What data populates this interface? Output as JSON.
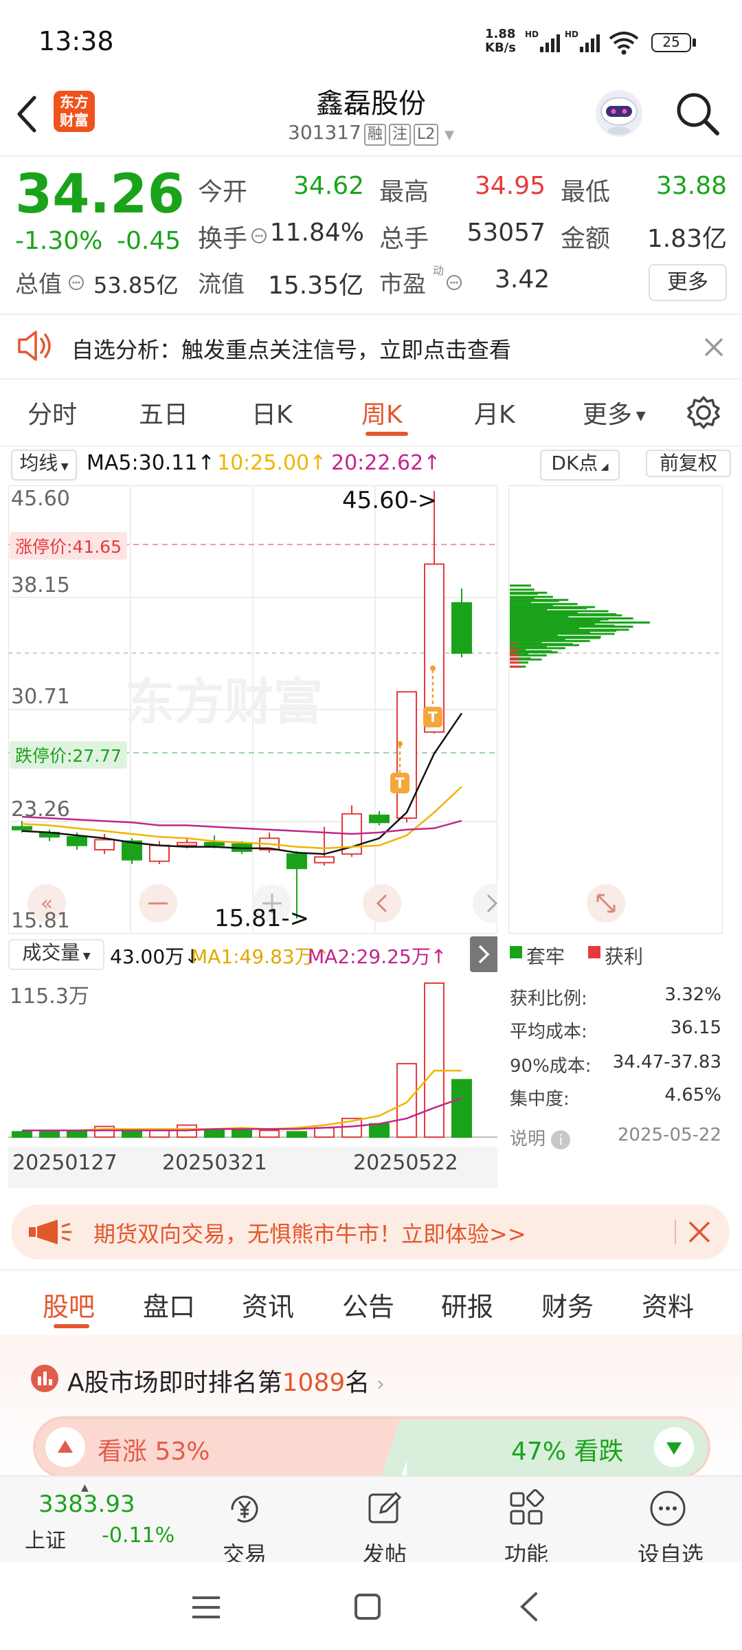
{
  "status": {
    "time": "13:38",
    "net_speed": "1.88",
    "net_unit": "KB/s",
    "battery": "25"
  },
  "header": {
    "app_logo": "东方财富",
    "title": "鑫磊股份",
    "code": "301317",
    "tags": [
      "融",
      "注",
      "L2"
    ]
  },
  "quote": {
    "price": "34.26",
    "change_pct": "-1.30%",
    "change": "-0.45",
    "rows": [
      [
        {
          "label": "今开",
          "value": "34.62",
          "color": "green"
        },
        {
          "label": "最高",
          "value": "34.95",
          "color": "red"
        },
        {
          "label": "最低",
          "value": "33.88",
          "color": "green"
        }
      ],
      [
        {
          "label": "换手",
          "value": "11.84%",
          "color": "plain"
        },
        {
          "label": "总手",
          "value": "53057",
          "color": "plain"
        },
        {
          "label": "金额",
          "value": "1.83亿",
          "color": "plain"
        }
      ]
    ],
    "row3": {
      "total_value_label": "总值",
      "total_value": "53.85亿",
      "float_label": "流值",
      "float_value": "15.35亿",
      "pe_label": "市盈",
      "pe_sup": "动",
      "pe_value": "3.42"
    },
    "more": "更多"
  },
  "notice": {
    "text": "自选分析：触发重点关注信号，立即点击查看"
  },
  "chart_tabs": [
    "分时",
    "五日",
    "日K",
    "周K",
    "月K",
    "更多"
  ],
  "active_tab": "周K",
  "indicators": {
    "selector": "均线",
    "ma5": "MA5:30.11↑",
    "ma10": "10:25.00↑",
    "ma20": "20:22.62↑",
    "dk": "DK点",
    "adjust": "前复权"
  },
  "price_axis": {
    "top": "45.60",
    "l2": "38.15",
    "l3": "30.71",
    "l4": "23.26",
    "bottom": "15.81"
  },
  "limits": {
    "up": "涨停价:41.65",
    "down": "跌停价:27.77"
  },
  "annotations": {
    "high": "45.60->",
    "low": "15.81->"
  },
  "volume": {
    "selector": "成交量",
    "value": "43.00万↓",
    "ma1": "MA1:49.83万↑",
    "ma2": "MA2:29.25万↑",
    "axis_max": "115.3万"
  },
  "dates": [
    "20250127",
    "20250321",
    "20250522"
  ],
  "chip": {
    "legend_trapped": "套牢",
    "legend_profit": "获利",
    "stats": [
      {
        "label": "获利比例:",
        "value": "3.32%"
      },
      {
        "label": "平均成本:",
        "value": "36.15"
      },
      {
        "label": "90%成本:",
        "value": "34.47-37.83"
      },
      {
        "label": "集中度:",
        "value": "4.65%"
      }
    ],
    "note_label": "说明",
    "date": "2025-05-22"
  },
  "ad": {
    "text": "期货双向交易，无惧熊市牛市！立即体验>>"
  },
  "bottom_tabs": [
    "股吧",
    "盘口",
    "资讯",
    "公告",
    "研报",
    "财务",
    "资料"
  ],
  "rank": {
    "prefix": "A股市场即时排名第",
    "number": "1089",
    "suffix": "名"
  },
  "sentiment": {
    "bull": "看涨 53%",
    "bear": "47% 看跌"
  },
  "nav": {
    "index_value": "3383.93",
    "index_name": "上证",
    "index_change": "-0.11%",
    "items": [
      "交易",
      "发帖",
      "功能",
      "设自选"
    ]
  },
  "colors": {
    "up": "#e63a3a",
    "down": "#1aa31a",
    "accent": "#e4572e",
    "ma5": "#111111",
    "ma10": "#f0b400",
    "ma20": "#c0268c"
  },
  "chart_data": {
    "type": "candlestick",
    "period": "weekly",
    "ylim": [
      15.81,
      45.6
    ],
    "candles": [
      {
        "o": 22.2,
        "c": 22.0,
        "h": 22.6,
        "l": 21.8
      },
      {
        "o": 21.8,
        "c": 21.5,
        "h": 22.0,
        "l": 21.2
      },
      {
        "o": 21.5,
        "c": 20.9,
        "h": 21.8,
        "l": 20.6
      },
      {
        "o": 20.6,
        "c": 21.3,
        "h": 21.7,
        "l": 20.3
      },
      {
        "o": 21.2,
        "c": 19.9,
        "h": 21.4,
        "l": 19.6
      },
      {
        "o": 19.8,
        "c": 20.9,
        "h": 21.2,
        "l": 19.6
      },
      {
        "o": 20.9,
        "c": 21.1,
        "h": 21.4,
        "l": 20.7
      },
      {
        "o": 21.1,
        "c": 20.9,
        "h": 21.6,
        "l": 20.7
      },
      {
        "o": 21.0,
        "c": 20.5,
        "h": 21.2,
        "l": 20.3
      },
      {
        "o": 20.6,
        "c": 21.4,
        "h": 21.8,
        "l": 20.4
      },
      {
        "o": 20.3,
        "c": 19.3,
        "h": 20.5,
        "l": 15.81
      },
      {
        "o": 19.7,
        "c": 20.1,
        "h": 22.2,
        "l": 19.5
      },
      {
        "o": 20.3,
        "c": 23.1,
        "h": 23.7,
        "l": 20.1
      },
      {
        "o": 23.0,
        "c": 22.5,
        "h": 23.3,
        "l": 22.3
      },
      {
        "o": 22.8,
        "c": 31.6,
        "h": 31.6,
        "l": 22.5
      },
      {
        "o": 28.8,
        "c": 40.5,
        "h": 45.6,
        "l": 28.7
      },
      {
        "o": 37.8,
        "c": 34.3,
        "h": 38.8,
        "l": 34.0
      }
    ],
    "ma5": [
      21.9,
      21.8,
      21.6,
      21.4,
      21.1,
      20.9,
      20.8,
      20.8,
      20.7,
      20.7,
      20.4,
      20.3,
      20.8,
      21.4,
      23.2,
      27.3,
      30.11
    ],
    "ma10": [
      22.4,
      22.3,
      22.1,
      21.9,
      21.7,
      21.5,
      21.4,
      21.2,
      21.1,
      21.0,
      20.8,
      20.7,
      20.8,
      20.9,
      21.6,
      23.2,
      25.0
    ],
    "ma20": [
      22.9,
      22.8,
      22.7,
      22.6,
      22.5,
      22.3,
      22.3,
      22.2,
      22.1,
      22.0,
      21.9,
      21.8,
      21.7,
      21.8,
      22.0,
      22.1,
      22.62
    ],
    "volume_ylim": [
      0,
      115.3
    ],
    "volumes": [
      4,
      4,
      5,
      8,
      6,
      6,
      9,
      5,
      6,
      5,
      4,
      7,
      14,
      10,
      55,
      115.3,
      43.0
    ],
    "volume_ma1": [
      5,
      5,
      5,
      6,
      6,
      6,
      6,
      6,
      7,
      6,
      7,
      9,
      12,
      16,
      26,
      49.83,
      49.83
    ],
    "volume_ma2": [
      5,
      5,
      5,
      5,
      5,
      5,
      5,
      6,
      6,
      6,
      6,
      7,
      8,
      10,
      14,
      22,
      29.25
    ],
    "chip_distribution": {
      "price_levels": [
        34.0,
        34.5,
        35.0,
        35.5,
        36.0,
        36.5,
        37.0,
        37.5,
        38.0,
        38.5
      ],
      "trapped_weight": [
        0.15,
        0.3,
        0.45,
        0.65,
        0.85,
        1.0,
        0.8,
        0.55,
        0.35,
        0.2
      ],
      "profit_weight": [
        0.08,
        0.05,
        0.0,
        0.0,
        0.0,
        0.0,
        0.0,
        0.0,
        0.0,
        0.0
      ]
    }
  }
}
